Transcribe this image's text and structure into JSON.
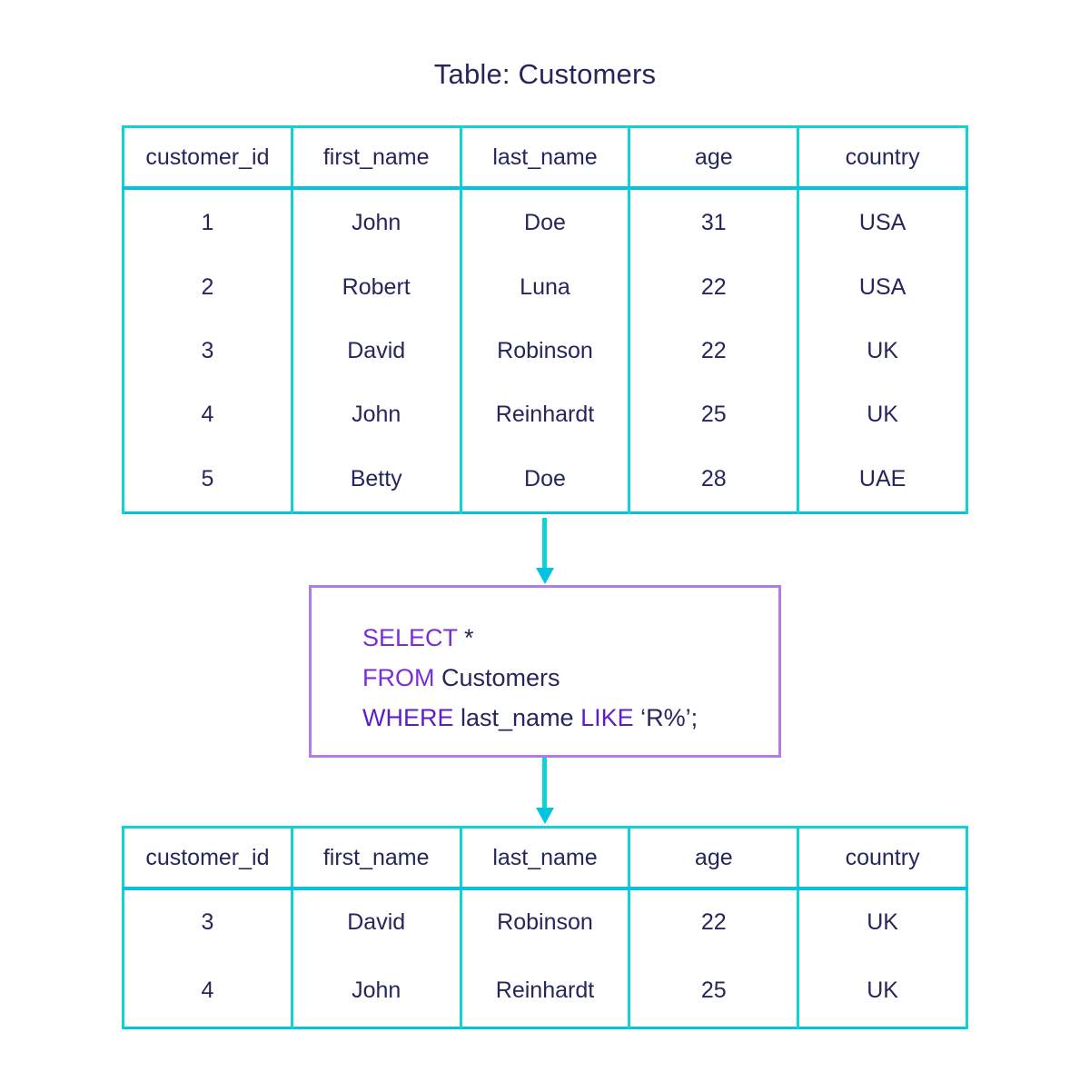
{
  "title": "Table: Customers",
  "columns": [
    "customer_id",
    "first_name",
    "last_name",
    "age",
    "country"
  ],
  "source_table": {
    "name": "Customers",
    "rows": [
      [
        "1",
        "John",
        "Doe",
        "31",
        "USA"
      ],
      [
        "2",
        "Robert",
        "Luna",
        "22",
        "USA"
      ],
      [
        "3",
        "David",
        "Robinson",
        "22",
        "UK"
      ],
      [
        "4",
        "John",
        "Reinhardt",
        "25",
        "UK"
      ],
      [
        "5",
        "Betty",
        "Doe",
        "28",
        "UAE"
      ]
    ]
  },
  "query": {
    "line1_kw": "SELECT",
    "line1_rest": " *",
    "line2_kw": "FROM",
    "line2_rest": " Customers",
    "line3_kw": "WHERE",
    "line3_mid": " last_name ",
    "line3_kw2": "LIKE",
    "line3_rest": " ‘R%’;"
  },
  "result_table": {
    "rows": [
      [
        "3",
        "David",
        "Robinson",
        "22",
        "UK"
      ],
      [
        "4",
        "John",
        "Reinhardt",
        "25",
        "UK"
      ]
    ]
  },
  "colors": {
    "table_border": "#0fd2d2",
    "header_divider": "#00c4e0",
    "code_border": "#b27be8",
    "keyword": "#7a2fd6",
    "text": "#25265e"
  }
}
